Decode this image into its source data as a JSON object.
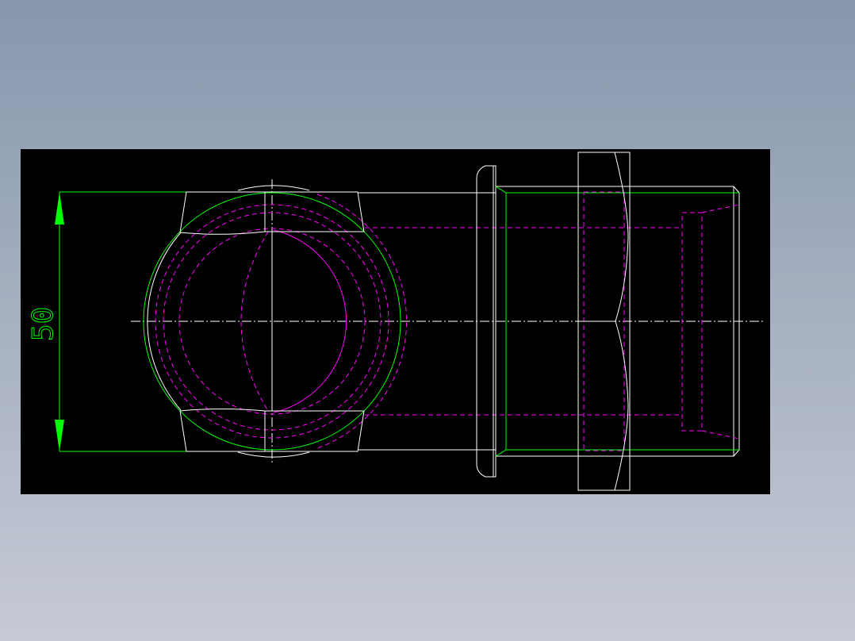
{
  "drawing": {
    "dimensions": [
      {
        "label": "50",
        "orientation": "vertical"
      }
    ],
    "colors": {
      "background": "#000000",
      "outline": "#ffffff",
      "dimension": "#00ff00",
      "hidden": "#ff00ff"
    }
  }
}
